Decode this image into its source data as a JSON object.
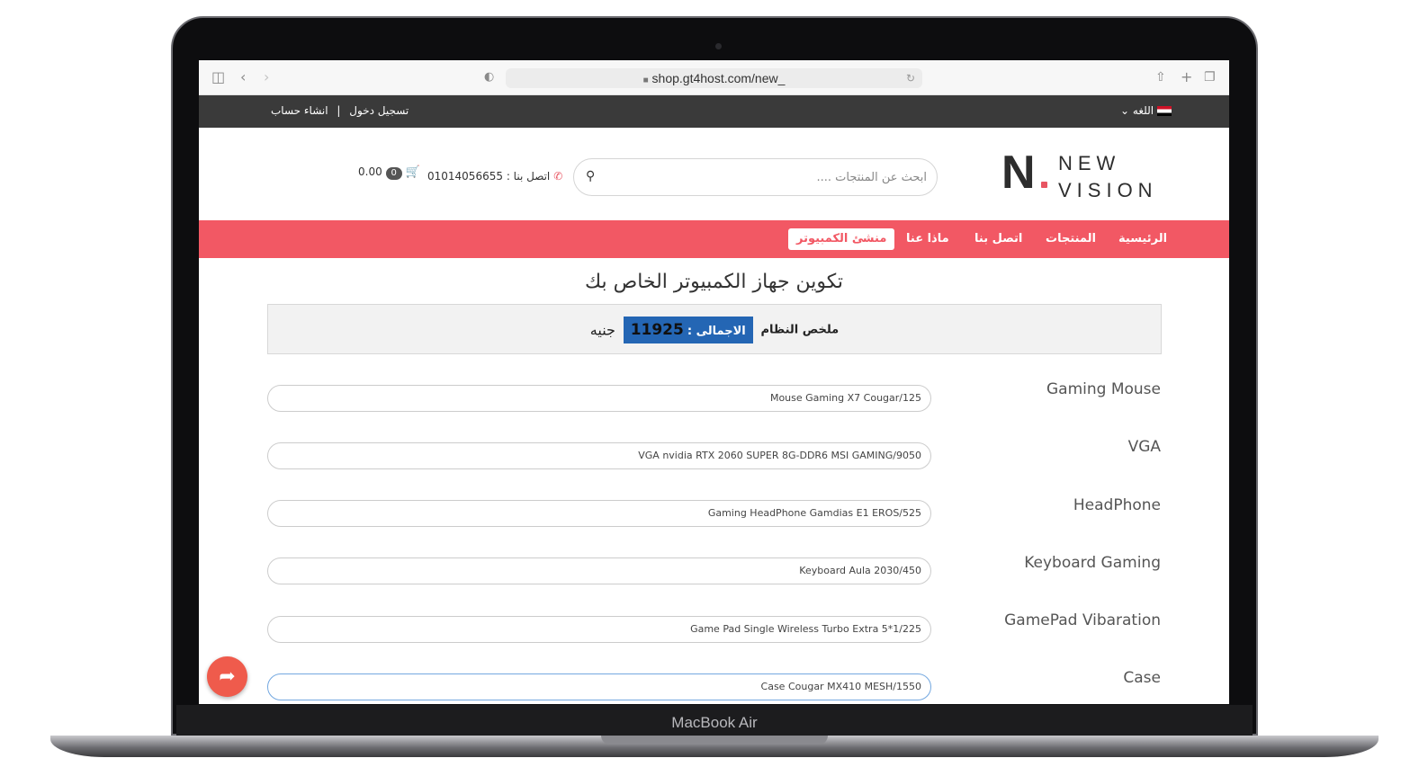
{
  "device": {
    "model": "MacBook Air"
  },
  "browser": {
    "url": "shop.gt4host.com/new_"
  },
  "topbar": {
    "language": "اللغه",
    "login": "تسجيل دخول",
    "separator": "|",
    "register": "انشاء حساب"
  },
  "header": {
    "logo_line1": "NEW",
    "logo_line2": "VISION",
    "logo_mark": "N",
    "search_placeholder": "ابحث عن المنتجات ....",
    "phone_label": "اتصل بنا :",
    "phone_number": "01014056655",
    "cart_count": "0",
    "cart_total": "0.00"
  },
  "nav": {
    "items": [
      "الرئيسية",
      "المنتجات",
      "اتصل بنا",
      "ماذا عنا"
    ],
    "active": "منشئ الكمبيوتر"
  },
  "main": {
    "title": "تكوين جهاز الكمبيوتر الخاص بك",
    "summary_label": "ملخص النظام",
    "total_label": "الاجمالى :",
    "total_value": "11925",
    "currency": "جنيه",
    "rows": [
      {
        "label": "Gaming Mouse",
        "value": "Mouse Gaming X7 Cougar/125"
      },
      {
        "label": "VGA",
        "value": "VGA nvidia RTX 2060 SUPER 8G-DDR6 MSI GAMING/9050"
      },
      {
        "label": "HeadPhone",
        "value": "Gaming HeadPhone Gamdias E1 EROS/525"
      },
      {
        "label": "Keyboard Gaming",
        "value": "Keyboard Aula 2030/450"
      },
      {
        "label": "GamePad Vibaration",
        "value": "Game Pad Single Wireless Turbo Extra 5*1/225"
      },
      {
        "label": "Case",
        "value": "Case Cougar MX410 MESH/1550"
      }
    ]
  },
  "colors": {
    "accent": "#f25864",
    "total_bg": "#2466b4",
    "share": "#ef5b4c"
  }
}
